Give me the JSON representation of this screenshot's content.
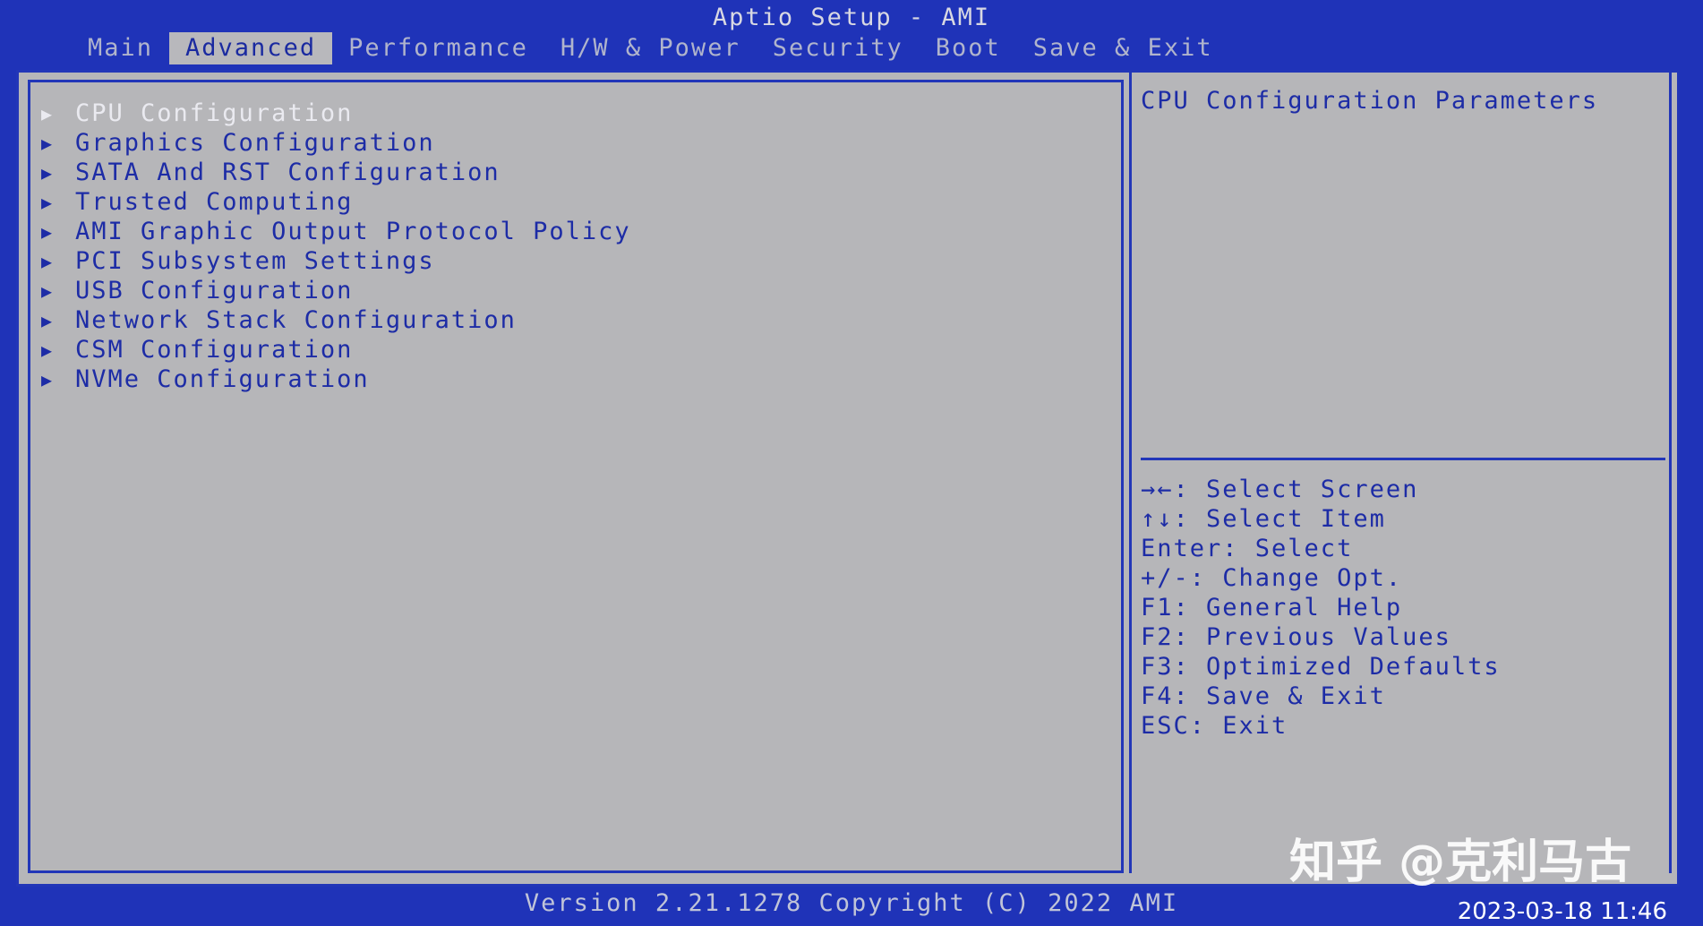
{
  "window": {
    "title": "Aptio Setup - AMI"
  },
  "tabs": [
    {
      "label": "Main"
    },
    {
      "label": "Advanced",
      "active": true
    },
    {
      "label": "Performance"
    },
    {
      "label": "H/W & Power"
    },
    {
      "label": "Security"
    },
    {
      "label": "Boot"
    },
    {
      "label": "Save & Exit"
    }
  ],
  "menu": {
    "items": [
      {
        "label": "CPU Configuration",
        "selected": true
      },
      {
        "label": "Graphics Configuration"
      },
      {
        "label": "SATA And RST Configuration"
      },
      {
        "label": "Trusted Computing"
      },
      {
        "label": "AMI Graphic Output Protocol Policy"
      },
      {
        "label": "PCI Subsystem Settings"
      },
      {
        "label": "USB Configuration"
      },
      {
        "label": "Network Stack Configuration"
      },
      {
        "label": "CSM Configuration"
      },
      {
        "label": "NVMe Configuration"
      }
    ],
    "arrow_icon": "triangle-right-icon"
  },
  "help": {
    "text": "CPU Configuration Parameters"
  },
  "keys": [
    {
      "text": "→←: Select Screen"
    },
    {
      "text": "↑↓: Select Item"
    },
    {
      "text": "Enter: Select"
    },
    {
      "text": "+/-: Change Opt."
    },
    {
      "text": "F1: General Help"
    },
    {
      "text": "F2: Previous Values"
    },
    {
      "text": "F3: Optimized Defaults"
    },
    {
      "text": "F4: Save & Exit"
    },
    {
      "text": "ESC: Exit"
    }
  ],
  "footer": {
    "version": "Version 2.21.1278 Copyright (C) 2022 AMI"
  },
  "overlay": {
    "watermark": "知乎 @克利马古",
    "datetime": "2023-03-18 11:46"
  },
  "colors": {
    "bios_blue": "#1f33b8",
    "panel_gray": "#b6b6b9",
    "text_blue": "#1d2ca6",
    "selected_text": "#eaeaf0"
  }
}
